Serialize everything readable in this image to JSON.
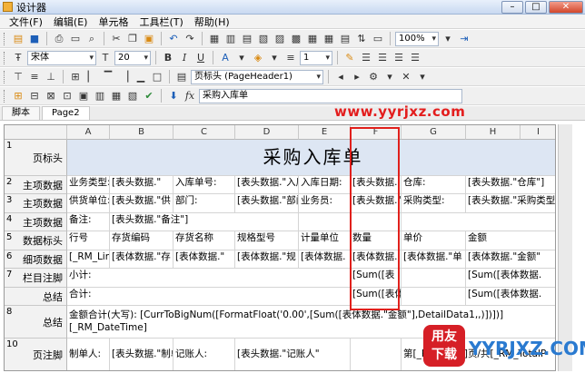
{
  "window": {
    "title": "设计器",
    "min": "–",
    "max": "□",
    "close": "✕"
  },
  "menu": [
    "文件(F)",
    "编辑(E)",
    "单元格",
    "工具栏(T)",
    "帮助(H)"
  ],
  "toolbar2": {
    "font": "宋体",
    "size": "20",
    "line_width": "1"
  },
  "toolbar3": {
    "page_band": "页标头 (PageHeader1)"
  },
  "toolbar4": {
    "formula_label": "fx",
    "formula_value": "采购入库单"
  },
  "zoom": "100%",
  "tabs": [
    "脚本",
    "Page2"
  ],
  "watermark": "www.yyrjxz.com",
  "logo": {
    "badge": "用友\n下载",
    "site": "YYRJXZ.COM"
  },
  "columns": [
    "A",
    "B",
    "C",
    "D",
    "E",
    "F",
    "G",
    "H",
    "I"
  ],
  "rows": [
    {
      "num": "1",
      "label": "页标头"
    },
    {
      "num": "2",
      "label": "主项数据"
    },
    {
      "num": "3",
      "label": "主项数据"
    },
    {
      "num": "4",
      "label": "主项数据"
    },
    {
      "num": "5",
      "label": "数据标头"
    },
    {
      "num": "6",
      "label": "细项数据"
    },
    {
      "num": "7",
      "label": "栏目注脚"
    },
    {
      "num": "",
      "label": "总结"
    },
    {
      "num": "8",
      "label": "总结"
    },
    {
      "num": "10",
      "label": "页注脚"
    }
  ],
  "cells": {
    "r1": "采购入库单",
    "r2": [
      "业务类型:",
      "[表头数据.\"",
      "入库单号:",
      "[表头数据.\"入库",
      "入库日期:",
      "[表头数据.",
      "仓库:",
      "[表头数据.\"仓库\"]"
    ],
    "r3": [
      "供货单位:",
      "[表头数据.\"供",
      "部门:",
      "[表头数据.\"部门\"]",
      "业务员:",
      "[表头数据.\"",
      "采购类型:",
      "[表头数据.\"采购类型\""
    ],
    "r4": [
      "备注:",
      "[表头数据.\"备注\"]"
    ],
    "r5": [
      "行号",
      "存货编码",
      "存货名称",
      "规格型号",
      "计量单位",
      "数量",
      "单价",
      "金额"
    ],
    "r6": [
      "[_RM_Lin",
      "[表体数据.\"存",
      "[表体数据.\"",
      "[表体数据.\"规",
      "[表体数据.",
      "[表体数据.",
      "[表体数据.\"单",
      "[表体数据.\"金额\""
    ],
    "r7": [
      "小计:",
      "[Sum([表",
      "[Sum([表体数据."
    ],
    "r7b": [
      "合计:",
      "[Sum([表体",
      "[Sum([表体数据."
    ],
    "r8a": "金额合计(大写): [CurrToBigNum([FormatFloat('0.00',[Sum([表体数据.\"金额\"],DetailData1,,)])])]",
    "r8b": "[_RM_DateTime]",
    "r10": [
      "制单人:",
      "[表头数据.\"制单",
      "记账人:",
      "[表头数据.\"记账人\"",
      "第[_RM_Page]页/共[_RM_TotalP"
    ]
  },
  "colors": {
    "highlight": "#e0201c",
    "watermark": "#e31d1d",
    "header_band": "#dde6f3"
  }
}
